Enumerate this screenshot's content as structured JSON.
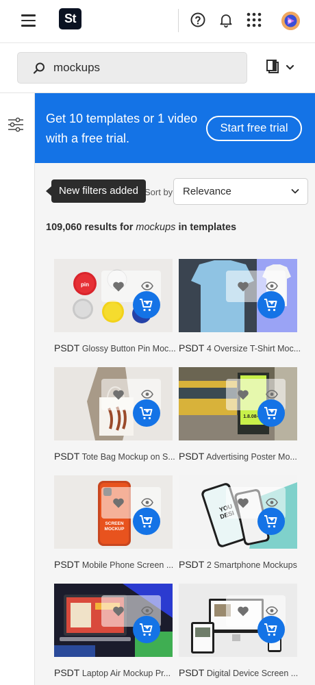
{
  "header": {
    "logo_text": "St",
    "icons": [
      "menu-icon",
      "help-icon",
      "notification-bell-icon",
      "apps-grid-icon",
      "avatar"
    ]
  },
  "search": {
    "value": "mockups",
    "placeholder": ""
  },
  "banner": {
    "text": "Get 10 templates or 1 video with a free trial.",
    "button": "Start free trial",
    "color": "#1473e6"
  },
  "sort": {
    "label": "Sort by",
    "value": "Relevance"
  },
  "tooltip": "New filters added",
  "results": {
    "count": "109,060",
    "prefix": "results for",
    "query": "mockups",
    "suffix": "in templates"
  },
  "cards": [
    {
      "type": "PSDT",
      "title": "Glossy Button Pin Moc..."
    },
    {
      "type": "PSDT",
      "title": "4 Oversize T-Shirt Moc..."
    },
    {
      "type": "PSDT",
      "title": "Tote Bag Mockup on S..."
    },
    {
      "type": "PSDT",
      "title": "Advertising Poster Mo..."
    },
    {
      "type": "PSDT",
      "title": "Mobile Phone Screen ..."
    },
    {
      "type": "PSDT",
      "title": "2 Smartphone Mockups"
    },
    {
      "type": "PSDT",
      "title": "Laptop Air Mockup Pr..."
    },
    {
      "type": "PSDT",
      "title": "Digital Device Screen ..."
    }
  ]
}
